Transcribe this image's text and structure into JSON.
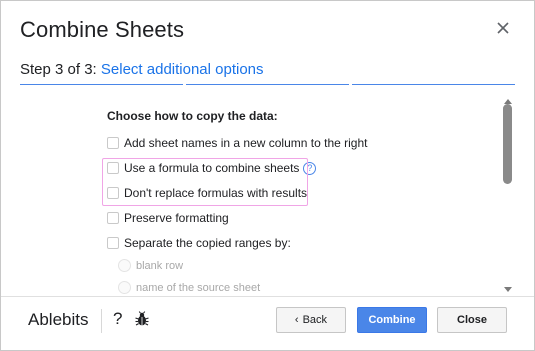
{
  "dialog": {
    "title": "Combine Sheets",
    "step_number": "Step 3 of 3:",
    "step_title": "Select additional options"
  },
  "content": {
    "heading": "Choose how to copy the data:",
    "options": [
      {
        "label": "Add sheet names in a new column to the right",
        "checked": false
      },
      {
        "label": "Use a formula to combine sheets",
        "checked": false,
        "help": "?"
      },
      {
        "label": "Don't replace formulas with results",
        "checked": false
      },
      {
        "label": "Preserve formatting",
        "checked": false
      },
      {
        "label": "Separate the copied ranges by:",
        "checked": false
      }
    ],
    "separator_choices": [
      {
        "label": "blank row",
        "disabled": true
      },
      {
        "label": "name of the source sheet",
        "disabled": true
      }
    ]
  },
  "footer": {
    "brand": "Ablebits",
    "help_label": "?",
    "back_label": "Back",
    "combine_label": "Combine",
    "close_label": "Close"
  },
  "colors": {
    "accent": "#4a86e8",
    "link": "#1a73e8",
    "highlight": "#f0a5e6"
  },
  "icons": [
    "close-icon",
    "help-icon",
    "bug-icon",
    "chevron-left-icon"
  ]
}
